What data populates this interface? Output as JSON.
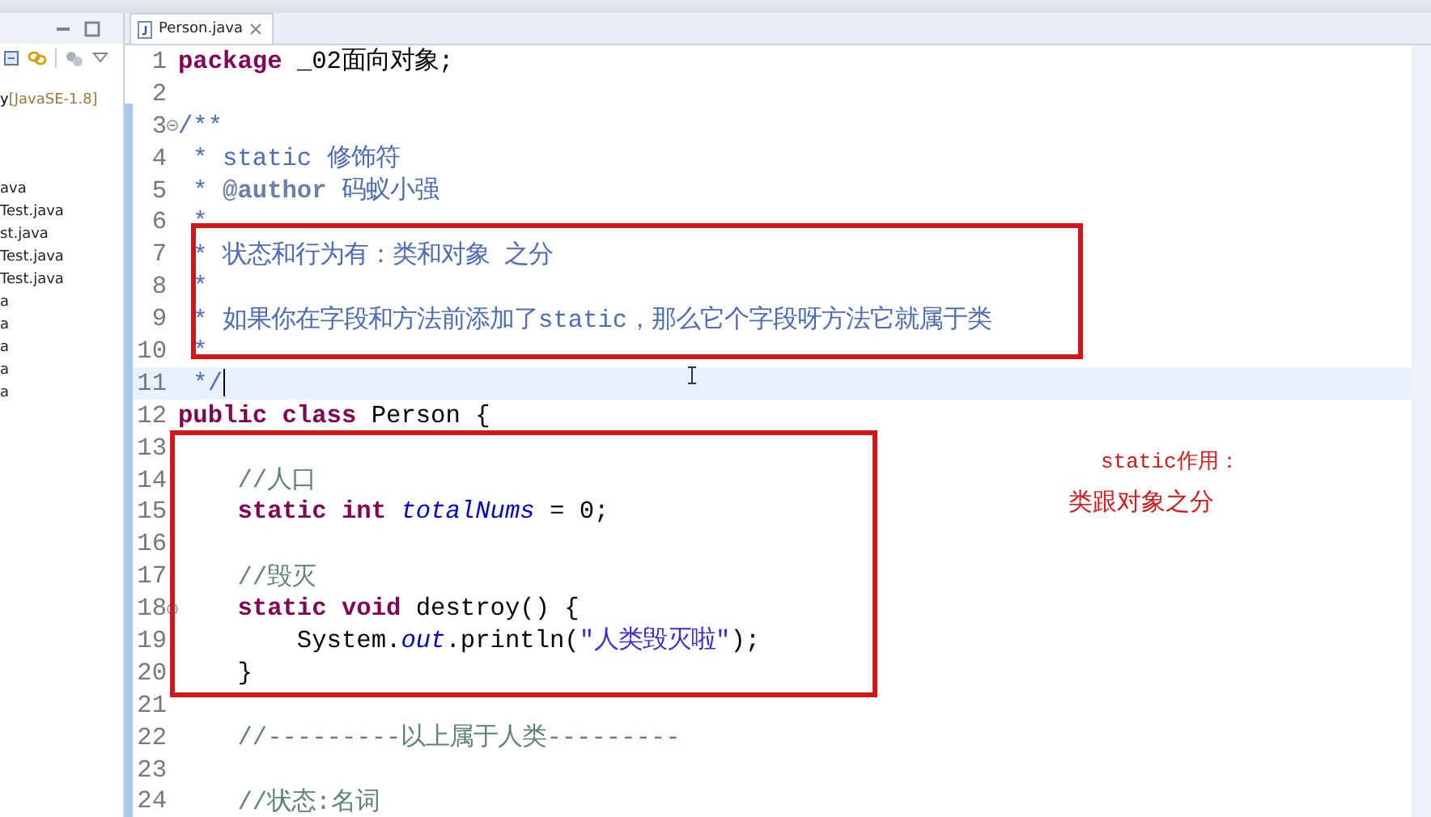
{
  "explorer": {
    "project": {
      "label": "y",
      "library": "[JavaSE-1.8]"
    },
    "items": [
      "ava",
      "Test.java",
      "st.java",
      "Test.java",
      "Test.java",
      "a",
      "a",
      "a",
      "a",
      "a"
    ]
  },
  "editor": {
    "tab": {
      "title": "Person.java",
      "selected": true
    },
    "lines": [
      {
        "number": "1",
        "folding": false,
        "current": false,
        "tokens": [
          {
            "kind": "keyword",
            "text": "package"
          },
          {
            "kind": "plain",
            "text": " _02面向对象;"
          }
        ]
      },
      {
        "number": "2",
        "folding": false,
        "current": false
      },
      {
        "number": "3",
        "folding": true,
        "current": false,
        "tokens": [
          {
            "kind": "javadoc",
            "text": "/**"
          }
        ]
      },
      {
        "number": "4",
        "folding": false,
        "current": false,
        "tokens": [
          {
            "kind": "javadoc",
            "text": " * static 修饰符"
          }
        ]
      },
      {
        "number": "5",
        "folding": false,
        "current": false,
        "tokens": [
          {
            "kind": "javadoc",
            "text": " *"
          },
          {
            "kind": "tag",
            "text": " @author"
          },
          {
            "kind": "javadoc",
            "text": " 码蚁小强"
          }
        ]
      },
      {
        "number": "6",
        "folding": false,
        "current": false,
        "tokens": [
          {
            "kind": "javadoc",
            "text": " *"
          }
        ]
      },
      {
        "number": "7",
        "folding": false,
        "current": false,
        "tokens": [
          {
            "kind": "javadoc",
            "text": " * 状态和行为有：类和对象 之分"
          }
        ]
      },
      {
        "number": "8",
        "folding": false,
        "current": false,
        "tokens": [
          {
            "kind": "javadoc",
            "text": " *"
          }
        ]
      },
      {
        "number": "9",
        "folding": false,
        "current": false,
        "tokens": [
          {
            "kind": "javadoc",
            "text": " * 如果你在字段和方法前添加了static，那么它个字段呀方法它就属于类"
          }
        ]
      },
      {
        "number": "10",
        "folding": false,
        "current": false,
        "tokens": [
          {
            "kind": "javadoc",
            "text": " *"
          }
        ]
      },
      {
        "number": "11",
        "folding": false,
        "current": true,
        "tokens": [
          {
            "kind": "javadoc",
            "text": " */"
          }
        ]
      },
      {
        "number": "12",
        "folding": false,
        "current": false,
        "tokens": [
          {
            "kind": "keyword",
            "text": "public"
          },
          {
            "kind": "keyword",
            "text": " class"
          },
          {
            "kind": "plain",
            "text": " Person {"
          }
        ]
      },
      {
        "number": "13",
        "folding": false,
        "current": false
      },
      {
        "number": "14",
        "folding": false,
        "current": false,
        "tokens": [
          {
            "kind": "comment",
            "text": "    //人口"
          }
        ]
      },
      {
        "number": "15",
        "folding": false,
        "current": false,
        "tokens": [
          {
            "kind": "keyword",
            "text": "    static"
          },
          {
            "kind": "keyword",
            "text": " int"
          },
          {
            "kind": "static-field",
            "text": " totalNums"
          },
          {
            "kind": "plain",
            "text": " = 0;"
          }
        ]
      },
      {
        "number": "16",
        "folding": false,
        "current": false
      },
      {
        "number": "17",
        "folding": false,
        "current": false,
        "tokens": [
          {
            "kind": "comment",
            "text": "    //毁灭"
          }
        ]
      },
      {
        "number": "18",
        "folding": true,
        "current": false,
        "tokens": [
          {
            "kind": "keyword",
            "text": "    static"
          },
          {
            "kind": "keyword",
            "text": " void"
          },
          {
            "kind": "plain",
            "text": " destroy() {"
          }
        ]
      },
      {
        "number": "19",
        "folding": false,
        "current": false,
        "tokens": [
          {
            "kind": "plain",
            "text": "        System."
          },
          {
            "kind": "static-field",
            "text": "out"
          },
          {
            "kind": "plain",
            "text": ".println("
          },
          {
            "kind": "string",
            "text": "\"人类毁灭啦\""
          },
          {
            "kind": "plain",
            "text": ");"
          }
        ]
      },
      {
        "number": "20",
        "folding": false,
        "current": false,
        "tokens": [
          {
            "kind": "plain",
            "text": "    }"
          }
        ]
      },
      {
        "number": "21",
        "folding": false,
        "current": false
      },
      {
        "number": "22",
        "folding": false,
        "current": false,
        "tokens": [
          {
            "kind": "comment",
            "text": "    //---------以上属于人类---------"
          }
        ]
      },
      {
        "number": "23",
        "folding": false,
        "current": false
      },
      {
        "number": "24",
        "folding": false,
        "current": false,
        "tokens": [
          {
            "kind": "comment",
            "text": "    //状态:名词"
          }
        ]
      }
    ]
  },
  "annotations": [
    "static作用：",
    "类跟对象之分"
  ]
}
